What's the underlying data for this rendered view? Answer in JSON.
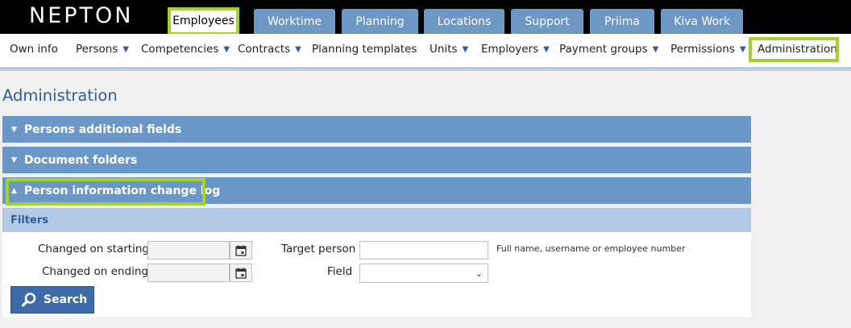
{
  "app": {
    "logo": "NEPTON"
  },
  "tabs": [
    {
      "label": "Employees",
      "active": true
    },
    {
      "label": "Worktime"
    },
    {
      "label": "Planning"
    },
    {
      "label": "Locations"
    },
    {
      "label": "Support"
    },
    {
      "label": "Priima"
    },
    {
      "label": "Kiva Work"
    }
  ],
  "subnav": [
    {
      "label": "Own info"
    },
    {
      "label": "Persons",
      "icon": "chevron-down-icon"
    },
    {
      "label": "Competencies",
      "icon": "chevron-down-icon"
    },
    {
      "label": "Contracts",
      "icon": "chevron-down-icon"
    },
    {
      "label": "Planning templates"
    },
    {
      "label": "Units",
      "icon": "chevron-down-icon"
    },
    {
      "label": "Employers",
      "icon": "chevron-down-icon"
    },
    {
      "label": "Payment groups",
      "icon": "chevron-down-icon"
    },
    {
      "label": "Permissions",
      "icon": "chevron-down-icon"
    },
    {
      "label": "Administration",
      "active": true
    }
  ],
  "page": {
    "title": "Administration"
  },
  "sections": [
    {
      "label": "Persons additional fields",
      "expanded": false
    },
    {
      "label": "Document folders",
      "expanded": false
    },
    {
      "label": "Person information change log",
      "expanded": true
    }
  ],
  "filters": {
    "title": "Filters",
    "changed_on_starting": {
      "label": "Changed on starting",
      "value": ""
    },
    "changed_on_ending": {
      "label": "Changed on ending",
      "value": ""
    },
    "target_person": {
      "label": "Target person",
      "value": "",
      "hint": "Full name, username or employee number"
    },
    "field": {
      "label": "Field",
      "value": ""
    },
    "search_button": "Search"
  },
  "colors": {
    "accent": "#6b97c8",
    "highlight": "#a4d12e",
    "title": "#2f5e9a"
  }
}
